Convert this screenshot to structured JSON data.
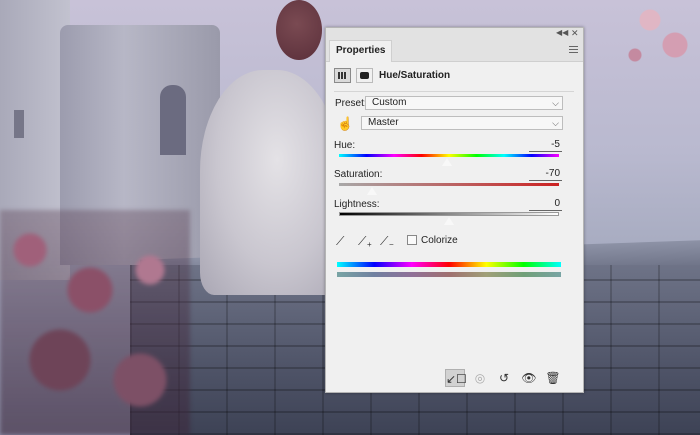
{
  "panel": {
    "tab_label": "Properties",
    "adjustment_title": "Hue/Saturation",
    "preset": {
      "label": "Preset:",
      "value": "Custom"
    },
    "channel": {
      "value": "Master"
    },
    "hue": {
      "label": "Hue:",
      "value": "-5",
      "level": 0.49
    },
    "saturation": {
      "label": "Saturation:",
      "value": "-70",
      "level": 0.15
    },
    "lightness": {
      "label": "Lightness:",
      "value": "0",
      "level": 0.5
    },
    "colorize": {
      "label": "Colorize",
      "checked": false
    }
  },
  "icons": {
    "collapse": "collapse-panel-icon",
    "close": "close-icon",
    "menu": "panel-menu-icon",
    "hand": "on-image-adjust-icon",
    "eyedropper": "eyedropper-icon",
    "eyedropper_add": "eyedropper-add-icon",
    "eyedropper_subtract": "eyedropper-subtract-icon",
    "clip": "clip-to-layer-icon",
    "view_previous": "view-previous-state-icon",
    "reset": "reset-icon",
    "visibility": "eye-icon",
    "delete": "trash-icon"
  },
  "colors": {
    "panel_bg": "#f0f0f0",
    "saturation_track_end": "#cc2222"
  }
}
